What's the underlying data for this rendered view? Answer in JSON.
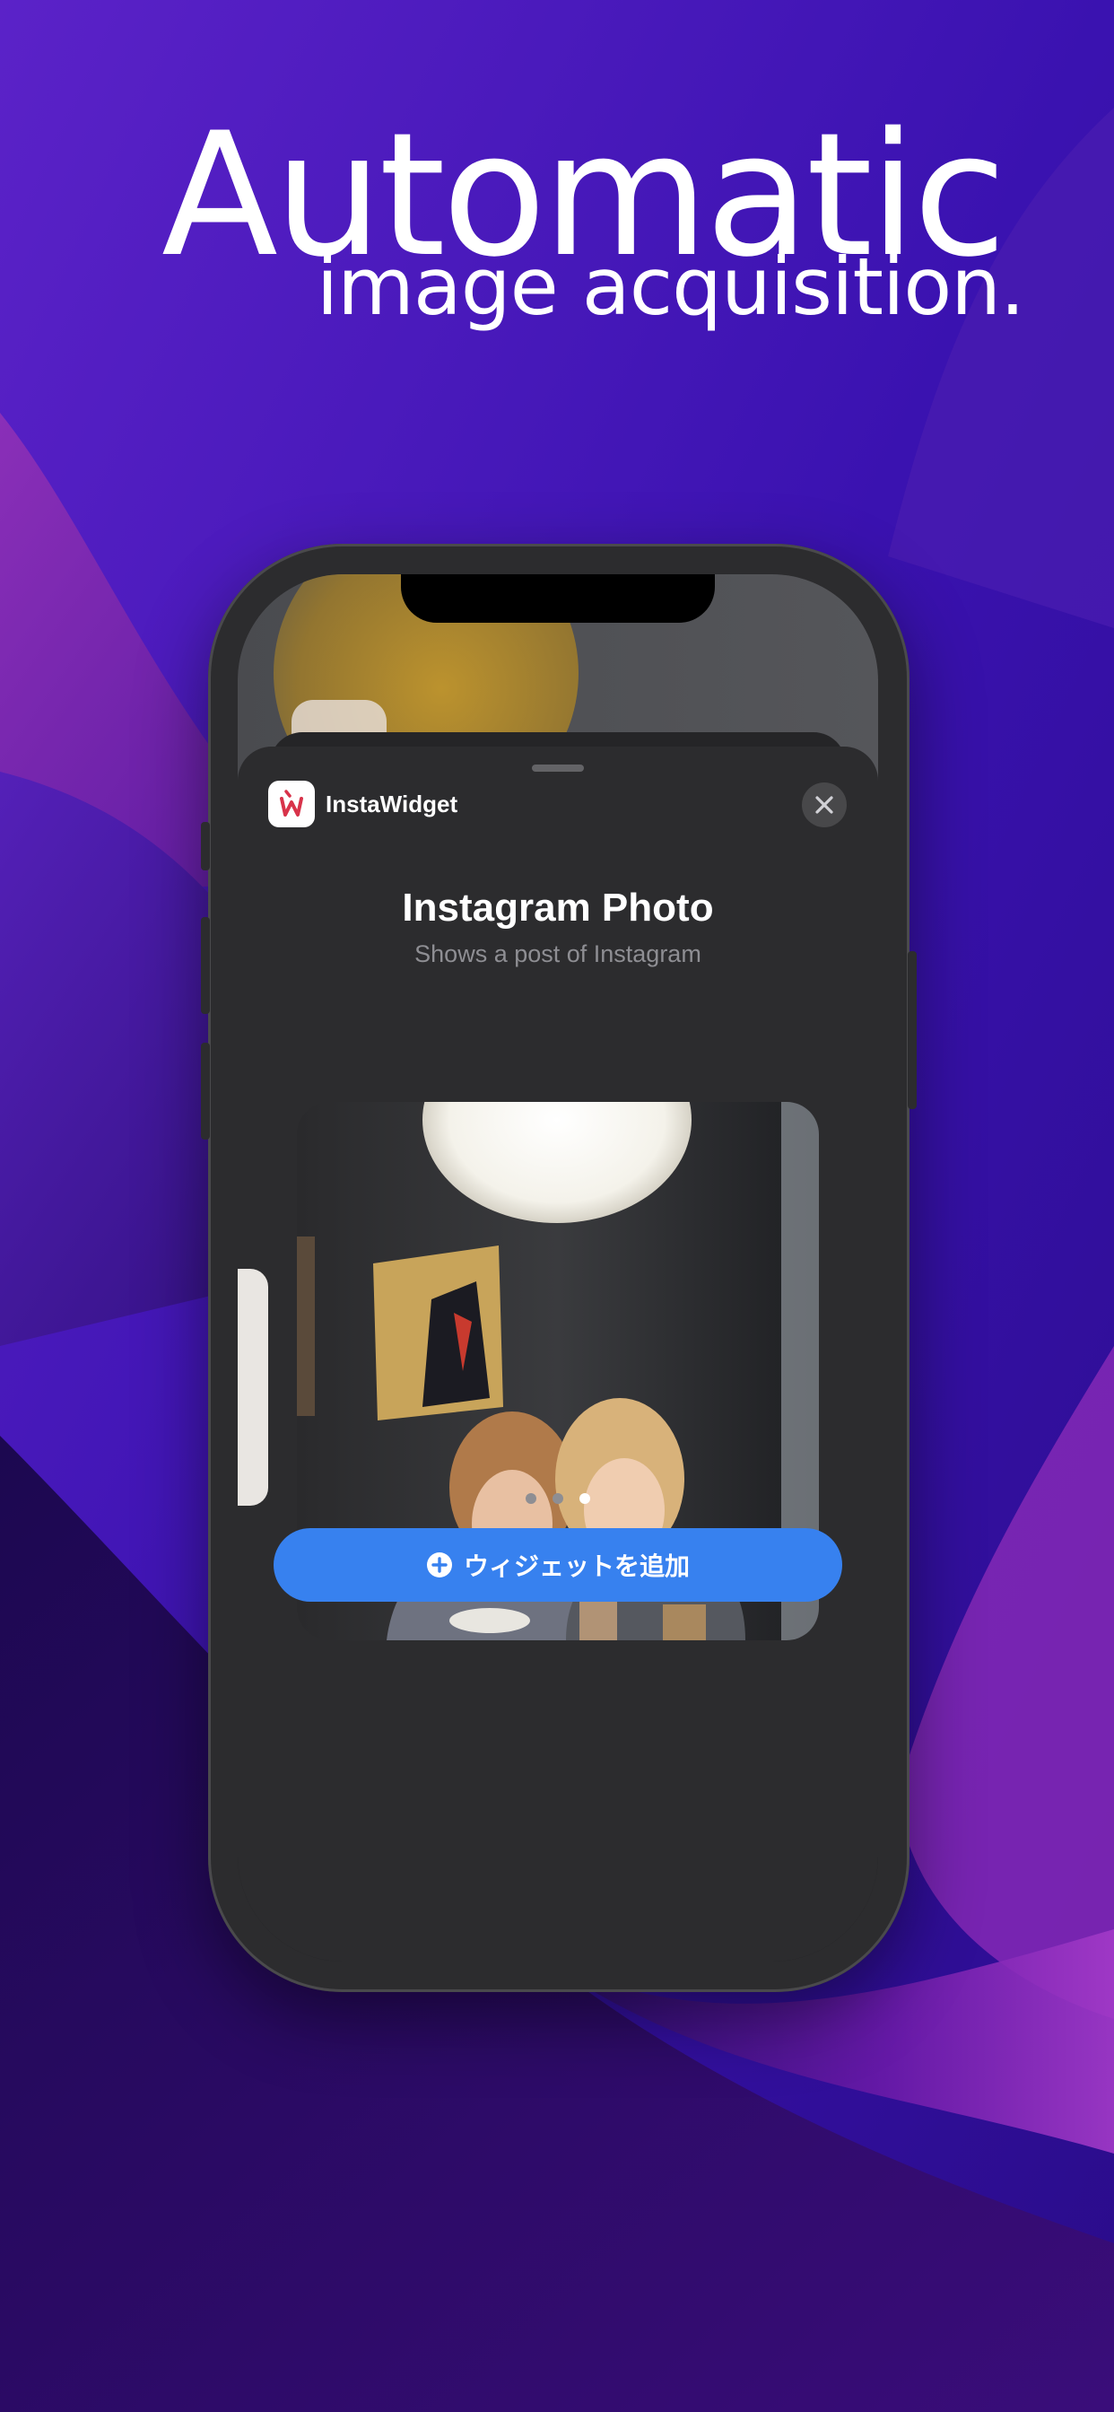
{
  "promo": {
    "headline": "Automatic",
    "subheadline": "image acquisition."
  },
  "widget_sheet": {
    "app_name": "InstaWidget",
    "title": "Instagram Photo",
    "subtitle": "Shows a post of Instagram",
    "page_indicator": {
      "count": 3,
      "active": 3
    },
    "add_button_label": "ウィジェットを追加"
  },
  "colors": {
    "accent_button": "#3781ef",
    "sheet_background": "#2c2c2e",
    "background_purple": "#2a0a6b",
    "app_icon_red": "#d8334a"
  },
  "icons": {
    "app": "instawidget-logo-icon",
    "close": "close-icon",
    "add": "plus-circle-icon"
  }
}
